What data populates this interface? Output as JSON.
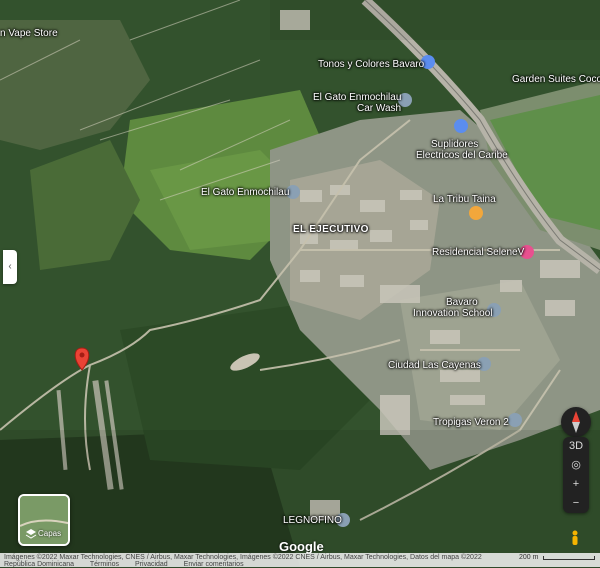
{
  "map": {
    "labels": {
      "vape_store": "n Vape Store",
      "tonos": "Tonos y Colores Bavaro",
      "garden_suites": "Garden Suites Cocot",
      "el_gato_car_wash_1": "El Gato Enmochilau",
      "el_gato_car_wash_2": "Car Wash",
      "suplidores_1": "Suplidores",
      "suplidores_2": "Electricos del Caribe",
      "el_gato": "El Gato Enmochilau",
      "la_tribu": "La Tribu Taina",
      "el_ejecutivo": "EL EJECUTIVO",
      "residencial": "Residencial SeleneV",
      "bavaro_1": "Bavaro",
      "bavaro_2": "Innovation School",
      "cayenas": "Ciudad Las Cayenas",
      "tropigas": "Tropigas Veron 2",
      "legnofino": "LEGNOFINO"
    }
  },
  "controls": {
    "collapse_icon": "chevron-left-icon",
    "collapse_glyph": "‹",
    "layers_label": "Capas",
    "layers_icon": "layers-icon",
    "compass_icon": "compass-icon",
    "btn_3d": "3D",
    "btn_locate": "◎",
    "btn_zoom_in": "+",
    "btn_zoom_out": "−"
  },
  "branding": {
    "google": "Google"
  },
  "footer": {
    "attribution": "Imágenes ©2022 Maxar Technologies, CNES / Airbus, Maxar Technologies, Imágenes ©2022 CNES / Airbus, Maxar Technologies, Datos del mapa ©2022",
    "region": "República Dominicana",
    "terms": "Términos",
    "privacy": "Privacidad",
    "feedback": "Enviar comentarios",
    "scale": "200 m"
  },
  "colors": {
    "pin_blue": "#5b8def",
    "pin_pink": "#e8508f",
    "pin_orange": "#f2a73b",
    "pin_gray": "#8aa0b4",
    "pin_red": "#ea4335"
  }
}
